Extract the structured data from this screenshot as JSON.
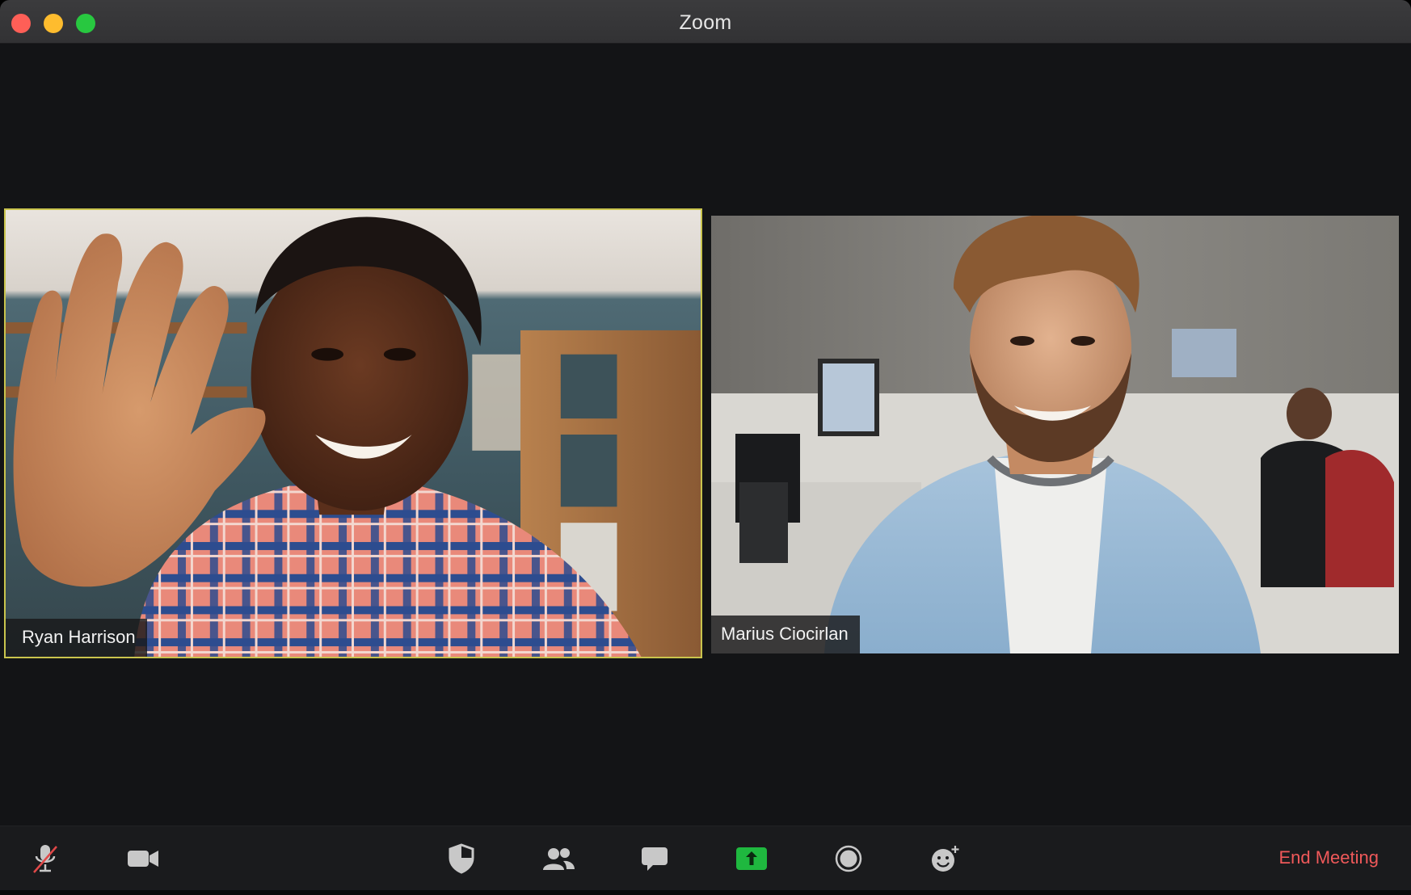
{
  "window": {
    "title": "Zoom"
  },
  "participants": [
    {
      "name": "Ryan Harrison",
      "active_speaker": true
    },
    {
      "name": "Marius Ciocirlan",
      "active_speaker": false
    }
  ],
  "toolbar": {
    "buttons": [
      {
        "icon": "microphone-muted-icon"
      },
      {
        "icon": "video-camera-icon"
      },
      {
        "icon": "security-shield-icon"
      },
      {
        "icon": "participants-icon"
      },
      {
        "icon": "chat-bubble-icon"
      },
      {
        "icon": "share-screen-icon"
      },
      {
        "icon": "record-icon"
      },
      {
        "icon": "reactions-icon"
      }
    ],
    "end_meeting_label": "End Meeting"
  },
  "colors": {
    "background": "#131416",
    "active_speaker_border": "#c9c44d",
    "share_screen_green": "#1fb83f",
    "end_meeting_red": "#f0595a",
    "mute_slash_red": "#e04848"
  }
}
